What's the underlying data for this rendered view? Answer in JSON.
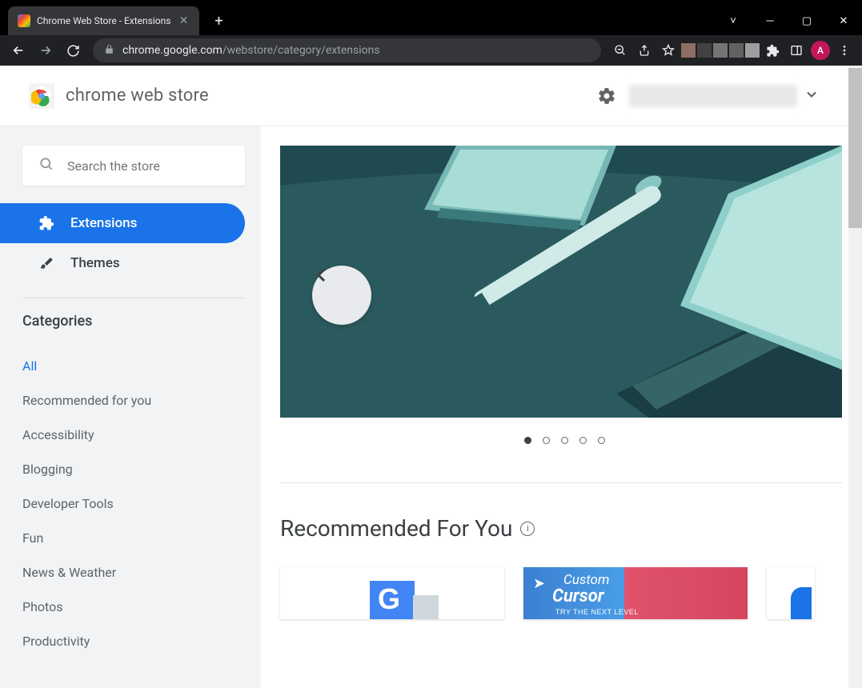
{
  "window": {
    "tab_title": "Chrome Web Store - Extensions",
    "url_host": "chrome.google.com",
    "url_path": "/webstore/category/extensions",
    "avatar_letter": "A"
  },
  "header": {
    "brand": "chrome web store"
  },
  "sidebar": {
    "search_placeholder": "Search the store",
    "nav": [
      {
        "label": "Extensions",
        "selected": true
      },
      {
        "label": "Themes",
        "selected": false
      }
    ],
    "categories_header": "Categories",
    "categories": [
      {
        "label": "All",
        "selected": true
      },
      {
        "label": "Recommended for you"
      },
      {
        "label": "Accessibility"
      },
      {
        "label": "Blogging"
      },
      {
        "label": "Developer Tools"
      },
      {
        "label": "Fun"
      },
      {
        "label": "News & Weather"
      },
      {
        "label": "Photos"
      },
      {
        "label": "Productivity"
      }
    ]
  },
  "main": {
    "carousel_dots": 5,
    "carousel_active": 0,
    "section_title": "Recommended For You",
    "cards": {
      "custom_cursor_top": "Custom",
      "custom_cursor_bottom": "Cursor",
      "custom_cursor_sub": "TRY THE NEXT LEVEL"
    }
  }
}
